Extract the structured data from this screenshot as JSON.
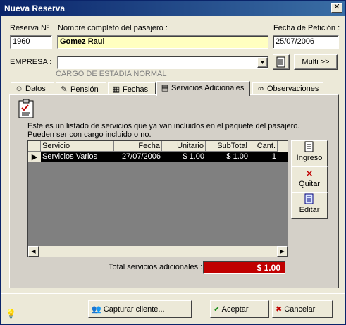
{
  "window": {
    "title": "Nueva Reserva",
    "close_glyph": "✕"
  },
  "form": {
    "reserva_label": "Reserva Nº",
    "reserva_value": "1960",
    "nombre_label": "Nombre completo del pasajero :",
    "nombre_value": "Gomez Raul",
    "fecha_label": "Fecha de Petición :",
    "fecha_value": "25/07/2006",
    "empresa_label": "EMPRESA :",
    "empresa_value": "",
    "cargo_text": "CARGO DE ESTADIA NORMAL",
    "multi_label": "Multi >>"
  },
  "tabs": [
    {
      "label": "Datos",
      "icon": "person-icon"
    },
    {
      "label": "Pensión",
      "icon": "pen-icon"
    },
    {
      "label": "Fechas",
      "icon": "calendar-icon"
    },
    {
      "label": "Servicios Adicionales",
      "icon": "services-icon"
    },
    {
      "label": "Observaciones",
      "icon": "glasses-icon"
    }
  ],
  "active_tab": "Servicios Adicionales",
  "panel": {
    "description_line1": "Este es un listado de servicios que ya van incluidos en el paquete del pasajero.",
    "description_line2": "Pueden ser con cargo incluido o no.",
    "columns": [
      "Servicio",
      "Fecha",
      "Unitario",
      "SubTotal",
      "Cant."
    ],
    "rows": [
      {
        "servicio": "Servicios Varios",
        "fecha": "27/07/2006",
        "unitario": "$ 1.00",
        "subtotal": "$ 1.00",
        "cant": "1"
      }
    ],
    "ingreso_label": "Ingreso",
    "quitar_label": "Quitar",
    "editar_label": "Editar",
    "total_label": "Total servicios adicionales :",
    "total_value": "$ 1.00"
  },
  "footer": {
    "capturar_label": "Capturar cliente...",
    "aceptar_label": "Aceptar",
    "cancelar_label": "Cancelar"
  },
  "colors": {
    "title_bar": "#0a246a",
    "total_bg": "#c00000",
    "name_bg": "#ffffc0"
  }
}
